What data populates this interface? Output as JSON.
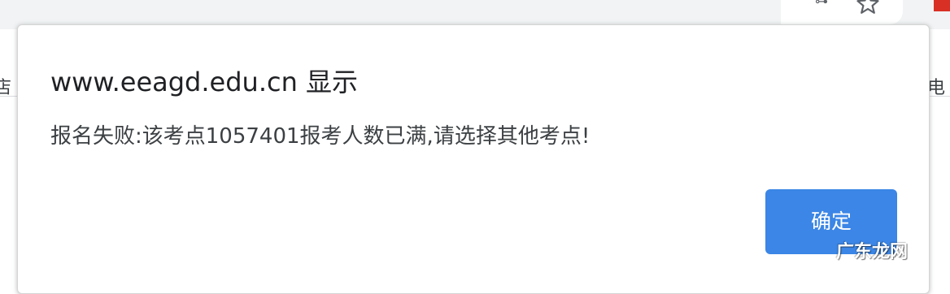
{
  "browser": {
    "star_icon": "star-icon",
    "bookmark_left_text": "店",
    "bookmark_right_text": "电",
    "extension_color": "#d93025"
  },
  "dialog": {
    "title": "www.eeagd.edu.cn 显示",
    "message": "报名失败:该考点1057401报考人数已满,请选择其他考点!",
    "ok_label": "确定",
    "ok_color": "#3b86e6"
  },
  "watermark": {
    "text": "广东龙网"
  }
}
